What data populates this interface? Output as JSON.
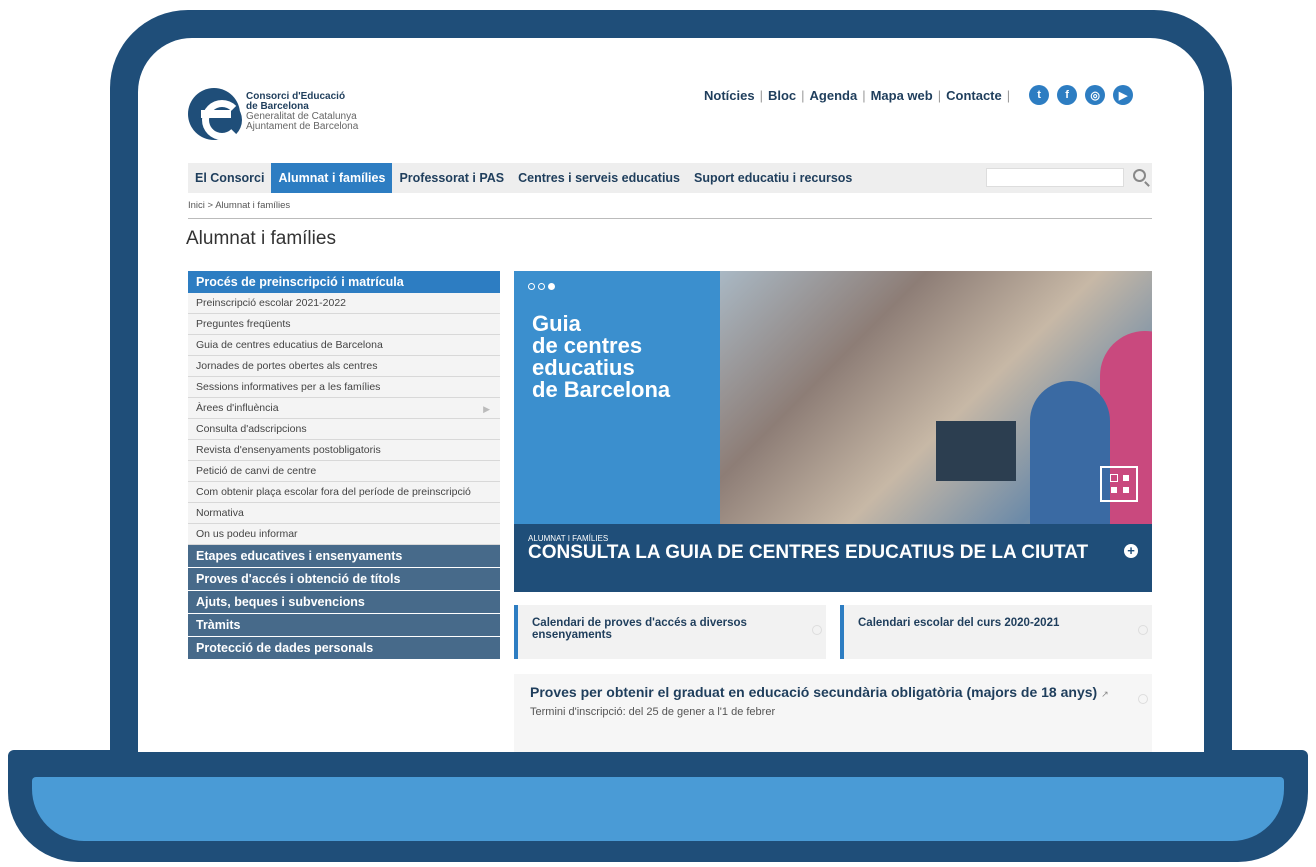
{
  "logo": {
    "line1": "Consorci d'Educació",
    "line2": "de Barcelona",
    "line3": "Generalitat de Catalunya",
    "line4": "Ajuntament de Barcelona"
  },
  "topnav": {
    "items": [
      "Notícies",
      "Bloc",
      "Agenda",
      "Mapa web",
      "Contacte"
    ],
    "social": [
      "twitter-icon",
      "facebook-icon",
      "instagram-icon",
      "youtube-icon"
    ]
  },
  "mainnav": {
    "items": [
      "El Consorci",
      "Alumnat i famílies",
      "Professorat i PAS",
      "Centres i serveis educatius",
      "Suport educatiu i recursos"
    ],
    "active": "Alumnat i famílies",
    "search_value": ""
  },
  "breadcrumb": "Inici > Alumnat i famílies",
  "page_title": "Alumnat i famílies",
  "sidebar": {
    "head": "Procés de preinscripció i matrícula",
    "items": [
      "Preinscripció escolar 2021-2022",
      "Preguntes freqüents",
      "Guia de centres educatius de Barcelona",
      "Jornades de portes obertes als centres",
      "Sessions informatives per a les famílies",
      "Àrees d'influència",
      "Consulta d'adscripcions",
      "Revista d'ensenyaments postobligatoris",
      "Petició de canvi de centre",
      "Com obtenir plaça escolar fora del període de preinscripció",
      "Normativa",
      "On us podeu informar"
    ],
    "sections": [
      "Etapes educatives i ensenyaments",
      "Proves d'accés i obtenció de títols",
      "Ajuts, beques i subvencions",
      "Tràmits",
      "Protecció de dades personals"
    ]
  },
  "hero": {
    "title_l1": "Guia",
    "title_l2": "de centres",
    "title_l3": "educatius",
    "title_l4": "de Barcelona",
    "category": "ALUMNAT I FAMÍLIES",
    "cta": "CONSULTA LA GUIA DE CENTRES EDUCATIUS DE LA CIUTAT"
  },
  "cards": {
    "card1": "Calendari de proves d'accés a diversos ensenyaments",
    "card2": "Calendari escolar del curs 2020-2021",
    "card3_title": "Proves per obtenir el graduat en educació secundària obligatòria (majors de 18 anys)",
    "card3_sub": "Termini d'inscripció: del 25 de gener a l'1 de febrer"
  },
  "colors": {
    "frame": "#1f4e79",
    "base": "#4a9bd6",
    "accent": "#2d7dc2",
    "section": "#476a8a"
  }
}
